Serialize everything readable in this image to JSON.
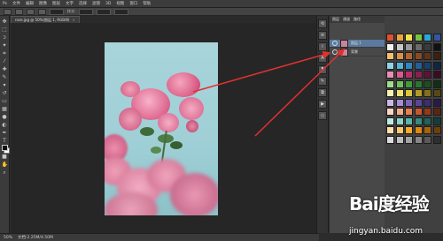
{
  "menu": {
    "items": [
      "Ps",
      "文件",
      "编辑",
      "图像",
      "图层",
      "文字",
      "选择",
      "滤镜",
      "3D",
      "视图",
      "窗口",
      "帮助"
    ]
  },
  "options_bar": {
    "label": "样式:"
  },
  "document": {
    "tab_label": "rose.jpg @ 50%(图层 1, RGB/8)",
    "close": "×"
  },
  "status": {
    "zoom": "50%",
    "info": "文档:2.25M/4.50M"
  },
  "layers": {
    "tabs": [
      "图层",
      "通道",
      "路径"
    ],
    "rows": [
      {
        "name": "图层 1"
      },
      {
        "name": "背景"
      }
    ]
  },
  "tools": [
    "move-tool",
    "marquee-tool",
    "lasso-tool",
    "magic-wand-tool",
    "crop-tool",
    "eyedropper-tool",
    "healing-tool",
    "brush-tool",
    "stamp-tool",
    "history-brush-tool",
    "eraser-tool",
    "gradient-tool",
    "blur-tool",
    "dodge-tool",
    "pen-tool",
    "type-tool",
    "path-select-tool",
    "shape-tool",
    "hand-tool",
    "zoom-tool"
  ],
  "swatch_colors": [
    "#e14f2e",
    "#f0a23b",
    "#f6e04b",
    "#7cc242",
    "#2ea6d8",
    "#3454a4",
    "#f2f2f2",
    "#c8c8c8",
    "#999999",
    "#6b6b6b",
    "#3b3b3b",
    "#111111",
    "#f5c06a",
    "#d8934a",
    "#b3652e",
    "#8a4a22",
    "#61331a",
    "#3d2010",
    "#8fd3e8",
    "#53b3d9",
    "#2f86c2",
    "#235f9a",
    "#17406d",
    "#0d2744",
    "#e88fb3",
    "#d9588e",
    "#b82d6a",
    "#8a1f50",
    "#5c1436",
    "#3a0d23",
    "#a4dc8e",
    "#6fc25a",
    "#3f9c3a",
    "#2a7530",
    "#1b4f21",
    "#103016",
    "#f7f3b0",
    "#efe070",
    "#dcc43c",
    "#b49a24",
    "#84701a",
    "#574a11",
    "#c9b8e8",
    "#a48ed6",
    "#7d63bd",
    "#5b449a",
    "#3e2d70",
    "#271c47",
    "#ffd5c2",
    "#f6ab86",
    "#e77f52",
    "#c7572d",
    "#94391c",
    "#5f2411",
    "#bfe9e3",
    "#8cd3c8",
    "#57b7a8",
    "#358c80",
    "#21635b",
    "#133e39",
    "#ffe1a8",
    "#ffc96b",
    "#ffa928",
    "#e08710",
    "#a9620a",
    "#6f3f06",
    "#dcdcdc",
    "#bfbfbf",
    "#a3a3a3",
    "#868686",
    "#5a5a5a",
    "#2e2e2e"
  ],
  "watermark": {
    "logo": "Bai度经验",
    "url": "jingyan.baidu.com"
  },
  "colors": {
    "annotation_arrow": "#e03131",
    "selected_layer": "#5b7a9e"
  }
}
